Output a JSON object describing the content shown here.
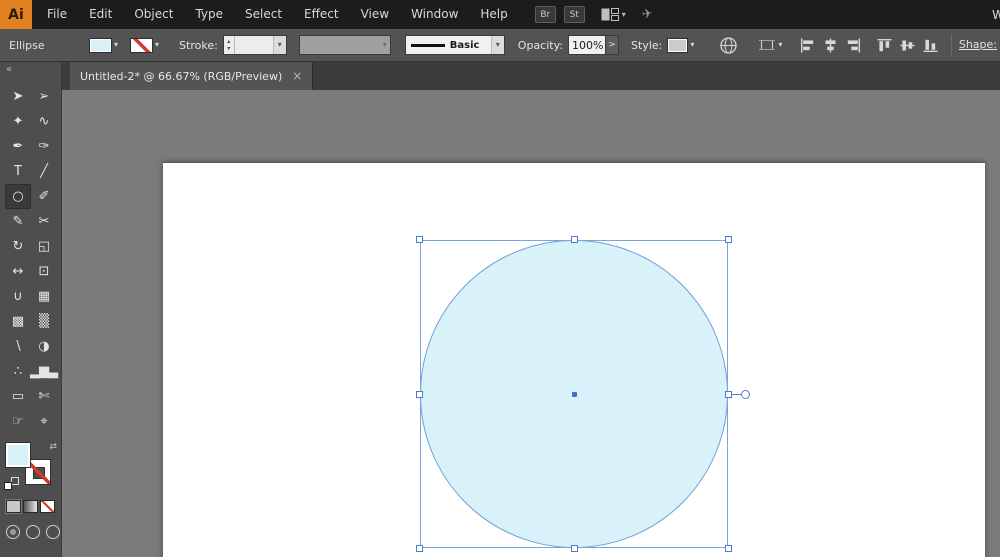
{
  "menubar": {
    "logo": "Ai",
    "items": [
      "File",
      "Edit",
      "Object",
      "Type",
      "Select",
      "Effect",
      "View",
      "Window",
      "Help"
    ],
    "bridge_label": "Br",
    "stock_label": "St",
    "right_partial_label": "W"
  },
  "control_bar": {
    "context_label": "Ellipse",
    "stroke_label": "Stroke:",
    "stroke_style": "Basic",
    "opacity_label": "Opacity:",
    "opacity_value": "100%",
    "opacity_more": ">",
    "style_label": "Style:",
    "shape_label": "Shape:"
  },
  "tab_bar": {
    "tab_title": "Untitled-2* @ 66.67% (RGB/Preview)",
    "close_glyph": "×"
  },
  "toolbar": {
    "collapse_glyph": "«",
    "tools": [
      {
        "name": "selection-tool",
        "glyph": "➤",
        "selected": false
      },
      {
        "name": "direct-selection-tool",
        "glyph": "➢",
        "selected": false
      },
      {
        "name": "magic-wand-tool",
        "glyph": "✦",
        "selected": false
      },
      {
        "name": "lasso-tool",
        "glyph": "∿",
        "selected": false
      },
      {
        "name": "pen-tool",
        "glyph": "✒",
        "selected": false
      },
      {
        "name": "curvature-tool",
        "glyph": "✑",
        "selected": false
      },
      {
        "name": "type-tool",
        "glyph": "T",
        "selected": false
      },
      {
        "name": "line-segment-tool",
        "glyph": "╱",
        "selected": false
      },
      {
        "name": "ellipse-tool",
        "glyph": "○",
        "selected": true
      },
      {
        "name": "paintbrush-tool",
        "glyph": "✐",
        "selected": false
      },
      {
        "name": "shaper-tool",
        "glyph": "✎",
        "selected": false
      },
      {
        "name": "scissors-tool",
        "glyph": "✂",
        "selected": false
      },
      {
        "name": "rotate-tool",
        "glyph": "↻",
        "selected": false
      },
      {
        "name": "scale-tool",
        "glyph": "◱",
        "selected": false
      },
      {
        "name": "width-tool",
        "glyph": "↔",
        "selected": false
      },
      {
        "name": "free-transform-tool",
        "glyph": "⊡",
        "selected": false
      },
      {
        "name": "shape-builder-tool",
        "glyph": "∪",
        "selected": false
      },
      {
        "name": "perspective-grid-tool",
        "glyph": "▦",
        "selected": false
      },
      {
        "name": "mesh-tool",
        "glyph": "▩",
        "selected": false
      },
      {
        "name": "gradient-tool",
        "glyph": "▒",
        "selected": false
      },
      {
        "name": "eyedropper-tool",
        "glyph": "∖",
        "selected": false
      },
      {
        "name": "blend-tool",
        "glyph": "◑",
        "selected": false
      },
      {
        "name": "symbol-sprayer-tool",
        "glyph": "∴",
        "selected": false
      },
      {
        "name": "column-graph-tool",
        "glyph": "▂▆▃",
        "selected": false
      },
      {
        "name": "artboard-tool",
        "glyph": "▭",
        "selected": false
      },
      {
        "name": "slice-tool",
        "glyph": "✄",
        "selected": false
      },
      {
        "name": "hand-tool",
        "glyph": "☞",
        "selected": false
      },
      {
        "name": "zoom-tool",
        "glyph": "⌖",
        "selected": false
      }
    ]
  },
  "swatches": {
    "fill_color": "#d8f0f8",
    "stroke_value": "none"
  },
  "canvas": {
    "shape": {
      "type": "ellipse",
      "fill": "#d9f2f9",
      "selection_color": "#4a7ccf"
    }
  },
  "glyphs": {
    "chevron_down": "▾",
    "stepper_up": "▴",
    "stepper_down": "▾",
    "swap": "⇄",
    "share": "✈"
  }
}
